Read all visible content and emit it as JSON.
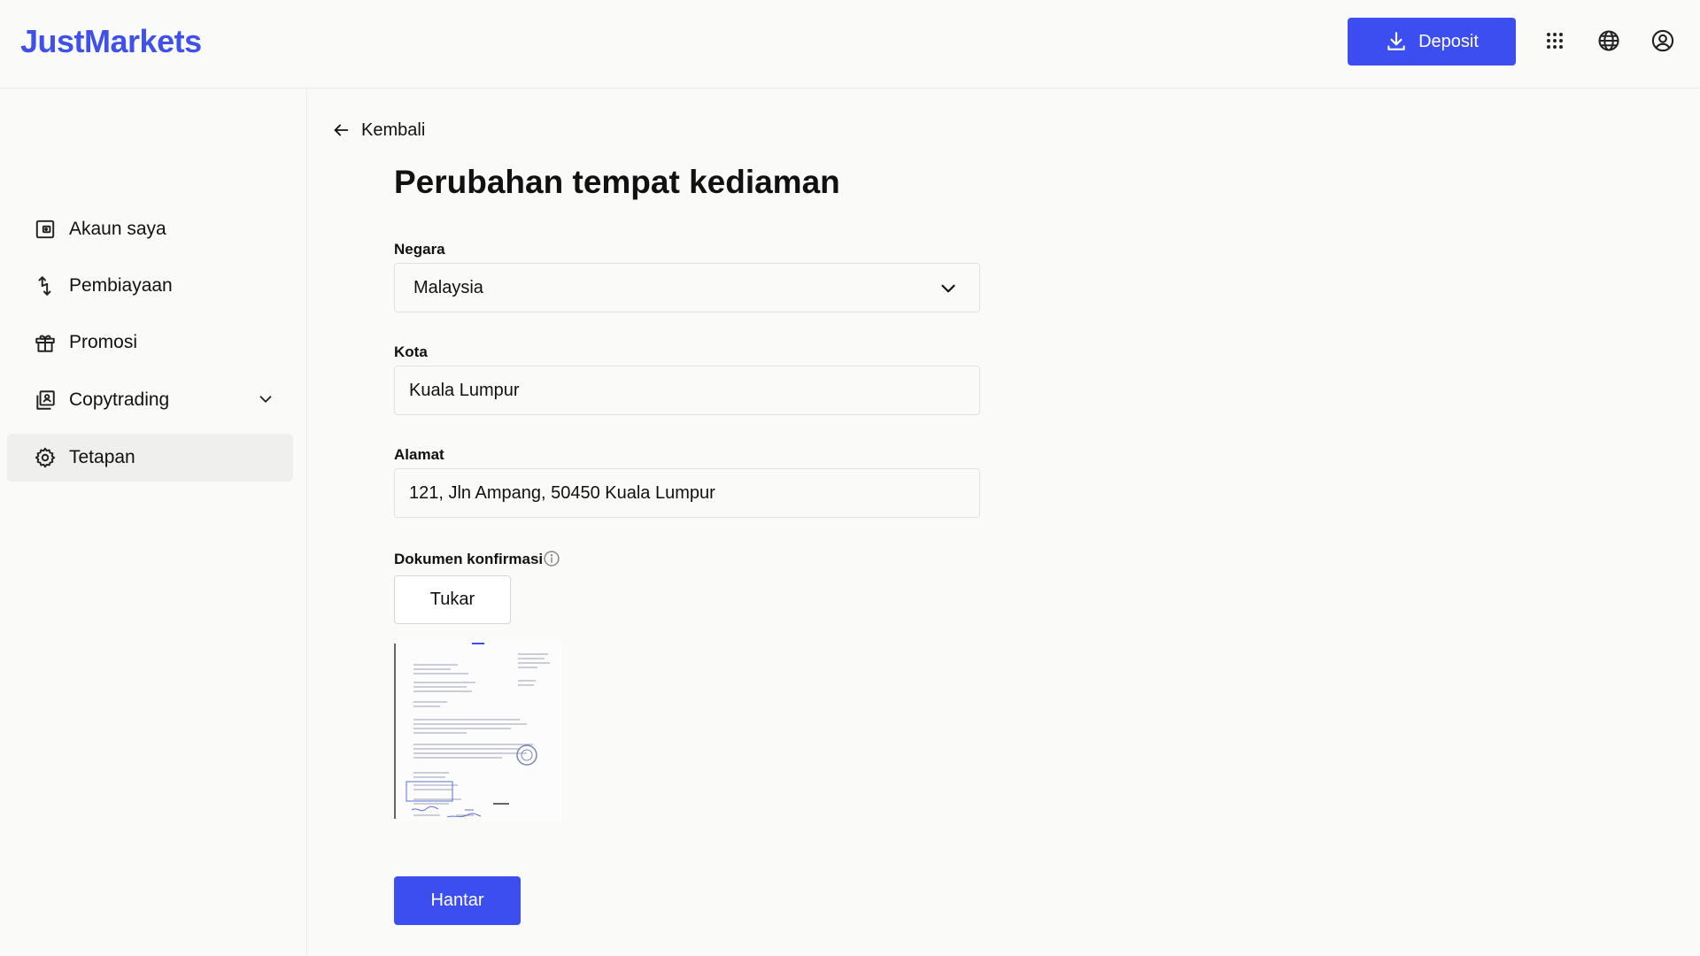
{
  "brand": {
    "name": "JustMarkets",
    "color": "#3f51e8"
  },
  "header": {
    "deposit_label": "Deposit",
    "icons": [
      "apps-grid-icon",
      "globe-icon",
      "user-profile-icon"
    ]
  },
  "sidebar": {
    "items": [
      {
        "label": "Akaun saya",
        "icon": "wallet-icon"
      },
      {
        "label": "Pembiayaan",
        "icon": "transfer-arrows-icon"
      },
      {
        "label": "Promosi",
        "icon": "gift-icon"
      },
      {
        "label": "Copytrading",
        "icon": "copytrading-icon",
        "expandable": true
      },
      {
        "label": "Tetapan",
        "icon": "gear-icon",
        "active": true
      }
    ]
  },
  "main": {
    "back_label": "Kembali",
    "title": "Perubahan tempat kediaman",
    "country": {
      "label": "Negara",
      "value": "Malaysia"
    },
    "city": {
      "label": "Kota",
      "value": "Kuala Lumpur"
    },
    "address": {
      "label": "Alamat",
      "value": "121, Jln Ampang, 50450 Kuala Lumpur"
    },
    "document": {
      "label": "Dokumen konfirmasi",
      "change_label": "Tukar"
    },
    "submit_label": "Hantar"
  },
  "colors": {
    "accent": "#3d4ef0",
    "background": "#fafaf9",
    "active_nav": "#efefee"
  }
}
